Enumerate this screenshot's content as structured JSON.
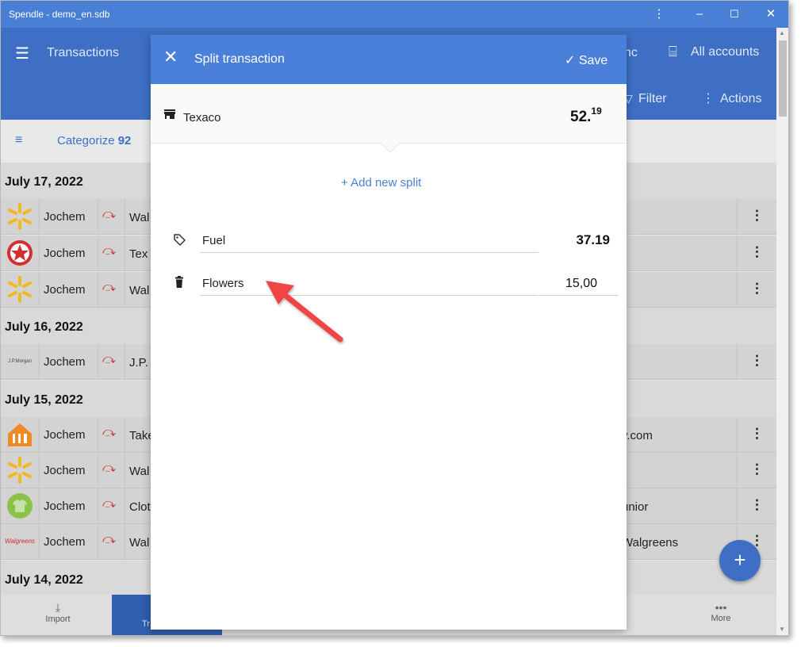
{
  "window": {
    "title": "Spendle - demo_en.sdb",
    "buttons": {
      "menu": "⋮",
      "minimize": "–",
      "maximize": "☐",
      "close": "✕"
    }
  },
  "appbar": {
    "section_title": "Transactions",
    "sync_label": "nc",
    "accounts_label": "All accounts",
    "filter_label": "Filter",
    "actions_label": "Actions"
  },
  "catbar": {
    "categorize_label": "Categorize",
    "categorize_count": "92"
  },
  "groups": [
    {
      "date": "July 17, 2022"
    },
    {
      "date": "July 16, 2022"
    },
    {
      "date": "July 15, 2022"
    },
    {
      "date": "July 14, 2022"
    }
  ],
  "rows": [
    {
      "person": "Jochem",
      "payee": "Wal",
      "right": "",
      "logo": "walmart-logo"
    },
    {
      "person": "Jochem",
      "payee": "Tex",
      "right": "",
      "logo": "texaco-logo"
    },
    {
      "person": "Jochem",
      "payee": "Wal",
      "right": "",
      "logo": "walmart-logo"
    },
    {
      "person": "Jochem",
      "payee": "J.P.",
      "right": "",
      "logo": "jpmorgan-logo",
      "logo_text": "J.P.Morgan"
    },
    {
      "person": "Jochem",
      "payee": "Take",
      "right": "y.com",
      "logo": "takeaway-logo"
    },
    {
      "person": "Jochem",
      "payee": "Wal",
      "right": "",
      "logo": "walmart-logo"
    },
    {
      "person": "Jochem",
      "payee": "Clot",
      "right": "unior",
      "logo": "clothing-logo"
    },
    {
      "person": "Jochem",
      "payee": "Wal",
      "right": "Walgreens",
      "logo": "walgreens-logo",
      "logo_text": "Walgreens"
    }
  ],
  "bottom_nav": {
    "import_label": "Import",
    "transactions_label": "Tr",
    "more_label": "More"
  },
  "dialog": {
    "title": "Split transaction",
    "save_label": "✓ Save",
    "payee": "Texaco",
    "amount_whole": "52.",
    "amount_cents": "19",
    "add_split_label": "+ Add new split",
    "splits": [
      {
        "category": "Fuel",
        "amount": "37.19"
      },
      {
        "category": "Flowers",
        "amount": "15,00"
      }
    ]
  },
  "colors": {
    "accent": "#4a80da",
    "appbar": "#3e6fc4",
    "annotation_arrow": "#ef4444"
  }
}
